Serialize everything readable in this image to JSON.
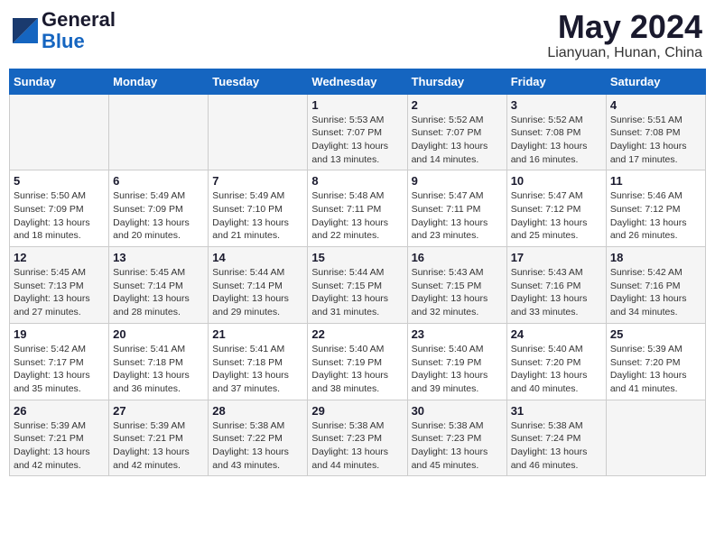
{
  "header": {
    "logo_line1": "General",
    "logo_line2": "Blue",
    "month_title": "May 2024",
    "location": "Lianyuan, Hunan, China"
  },
  "days_of_week": [
    "Sunday",
    "Monday",
    "Tuesday",
    "Wednesday",
    "Thursday",
    "Friday",
    "Saturday"
  ],
  "weeks": [
    [
      {
        "day": "",
        "info": ""
      },
      {
        "day": "",
        "info": ""
      },
      {
        "day": "",
        "info": ""
      },
      {
        "day": "1",
        "info": "Sunrise: 5:53 AM\nSunset: 7:07 PM\nDaylight: 13 hours\nand 13 minutes."
      },
      {
        "day": "2",
        "info": "Sunrise: 5:52 AM\nSunset: 7:07 PM\nDaylight: 13 hours\nand 14 minutes."
      },
      {
        "day": "3",
        "info": "Sunrise: 5:52 AM\nSunset: 7:08 PM\nDaylight: 13 hours\nand 16 minutes."
      },
      {
        "day": "4",
        "info": "Sunrise: 5:51 AM\nSunset: 7:08 PM\nDaylight: 13 hours\nand 17 minutes."
      }
    ],
    [
      {
        "day": "5",
        "info": "Sunrise: 5:50 AM\nSunset: 7:09 PM\nDaylight: 13 hours\nand 18 minutes."
      },
      {
        "day": "6",
        "info": "Sunrise: 5:49 AM\nSunset: 7:09 PM\nDaylight: 13 hours\nand 20 minutes."
      },
      {
        "day": "7",
        "info": "Sunrise: 5:49 AM\nSunset: 7:10 PM\nDaylight: 13 hours\nand 21 minutes."
      },
      {
        "day": "8",
        "info": "Sunrise: 5:48 AM\nSunset: 7:11 PM\nDaylight: 13 hours\nand 22 minutes."
      },
      {
        "day": "9",
        "info": "Sunrise: 5:47 AM\nSunset: 7:11 PM\nDaylight: 13 hours\nand 23 minutes."
      },
      {
        "day": "10",
        "info": "Sunrise: 5:47 AM\nSunset: 7:12 PM\nDaylight: 13 hours\nand 25 minutes."
      },
      {
        "day": "11",
        "info": "Sunrise: 5:46 AM\nSunset: 7:12 PM\nDaylight: 13 hours\nand 26 minutes."
      }
    ],
    [
      {
        "day": "12",
        "info": "Sunrise: 5:45 AM\nSunset: 7:13 PM\nDaylight: 13 hours\nand 27 minutes."
      },
      {
        "day": "13",
        "info": "Sunrise: 5:45 AM\nSunset: 7:14 PM\nDaylight: 13 hours\nand 28 minutes."
      },
      {
        "day": "14",
        "info": "Sunrise: 5:44 AM\nSunset: 7:14 PM\nDaylight: 13 hours\nand 29 minutes."
      },
      {
        "day": "15",
        "info": "Sunrise: 5:44 AM\nSunset: 7:15 PM\nDaylight: 13 hours\nand 31 minutes."
      },
      {
        "day": "16",
        "info": "Sunrise: 5:43 AM\nSunset: 7:15 PM\nDaylight: 13 hours\nand 32 minutes."
      },
      {
        "day": "17",
        "info": "Sunrise: 5:43 AM\nSunset: 7:16 PM\nDaylight: 13 hours\nand 33 minutes."
      },
      {
        "day": "18",
        "info": "Sunrise: 5:42 AM\nSunset: 7:16 PM\nDaylight: 13 hours\nand 34 minutes."
      }
    ],
    [
      {
        "day": "19",
        "info": "Sunrise: 5:42 AM\nSunset: 7:17 PM\nDaylight: 13 hours\nand 35 minutes."
      },
      {
        "day": "20",
        "info": "Sunrise: 5:41 AM\nSunset: 7:18 PM\nDaylight: 13 hours\nand 36 minutes."
      },
      {
        "day": "21",
        "info": "Sunrise: 5:41 AM\nSunset: 7:18 PM\nDaylight: 13 hours\nand 37 minutes."
      },
      {
        "day": "22",
        "info": "Sunrise: 5:40 AM\nSunset: 7:19 PM\nDaylight: 13 hours\nand 38 minutes."
      },
      {
        "day": "23",
        "info": "Sunrise: 5:40 AM\nSunset: 7:19 PM\nDaylight: 13 hours\nand 39 minutes."
      },
      {
        "day": "24",
        "info": "Sunrise: 5:40 AM\nSunset: 7:20 PM\nDaylight: 13 hours\nand 40 minutes."
      },
      {
        "day": "25",
        "info": "Sunrise: 5:39 AM\nSunset: 7:20 PM\nDaylight: 13 hours\nand 41 minutes."
      }
    ],
    [
      {
        "day": "26",
        "info": "Sunrise: 5:39 AM\nSunset: 7:21 PM\nDaylight: 13 hours\nand 42 minutes."
      },
      {
        "day": "27",
        "info": "Sunrise: 5:39 AM\nSunset: 7:21 PM\nDaylight: 13 hours\nand 42 minutes."
      },
      {
        "day": "28",
        "info": "Sunrise: 5:38 AM\nSunset: 7:22 PM\nDaylight: 13 hours\nand 43 minutes."
      },
      {
        "day": "29",
        "info": "Sunrise: 5:38 AM\nSunset: 7:23 PM\nDaylight: 13 hours\nand 44 minutes."
      },
      {
        "day": "30",
        "info": "Sunrise: 5:38 AM\nSunset: 7:23 PM\nDaylight: 13 hours\nand 45 minutes."
      },
      {
        "day": "31",
        "info": "Sunrise: 5:38 AM\nSunset: 7:24 PM\nDaylight: 13 hours\nand 46 minutes."
      },
      {
        "day": "",
        "info": ""
      }
    ]
  ]
}
